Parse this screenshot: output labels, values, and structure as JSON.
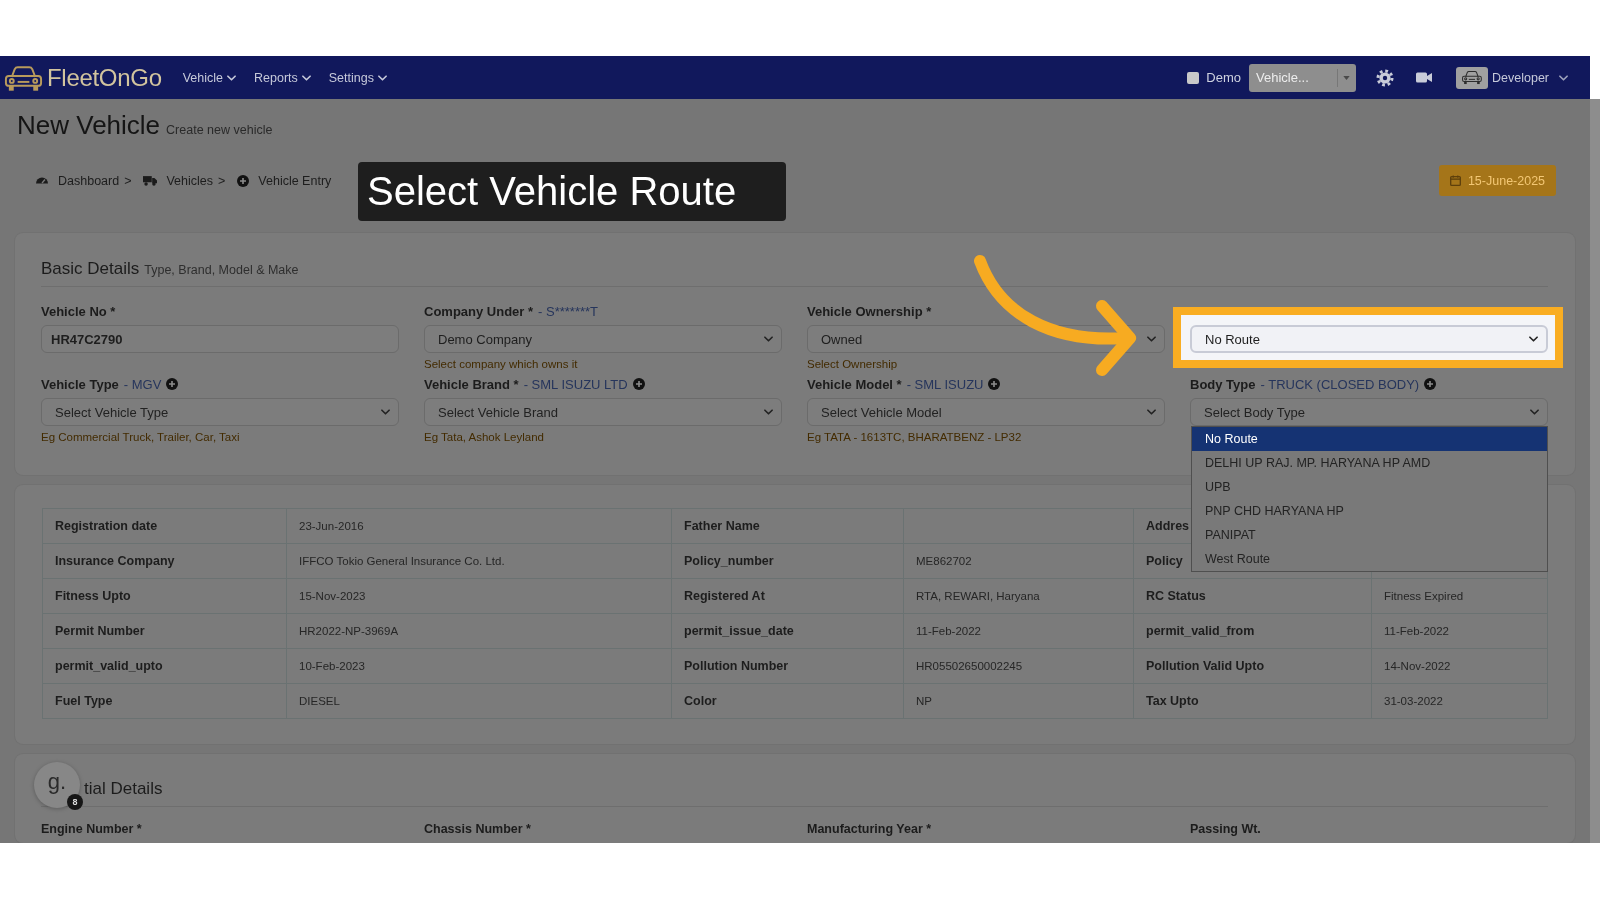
{
  "navbar": {
    "logo": "FleetOnGo",
    "menu": [
      {
        "label": "Vehicle"
      },
      {
        "label": "Reports"
      },
      {
        "label": "Settings"
      }
    ],
    "demo": {
      "label": "Demo",
      "checked": false
    },
    "vehicle_select": {
      "value": "Vehicle..."
    },
    "user": {
      "name": "Developer"
    }
  },
  "page_header": {
    "title": "New Vehicle",
    "subtitle": "Create new vehicle"
  },
  "breadcrumb": [
    {
      "kind": "dashboard",
      "label": "Dashboard",
      "separator": ">"
    },
    {
      "kind": "vehicles",
      "label": "Vehicles",
      "separator": ">"
    },
    {
      "kind": "entry",
      "label": "Vehicle Entry"
    }
  ],
  "tutorial": {
    "callout": "Select Vehicle Route"
  },
  "date_button": {
    "label": "15-June-2025"
  },
  "basic_details": {
    "title": "Basic Details",
    "subtitle": "Type, Brand, Model & Make",
    "fields": [
      {
        "kind": "input",
        "label": "Vehicle No *",
        "add_button": false,
        "spotlight": false,
        "value": "HR47C2790"
      },
      {
        "kind": "select",
        "label": "Company Under *",
        "note": "- S*******T",
        "add_button": false,
        "spotlight": false,
        "value": "Demo Company",
        "hint": "Select company which owns it"
      },
      {
        "kind": "select",
        "label": "Vehicle Ownership *",
        "add_button": false,
        "spotlight": false,
        "value": "Owned",
        "hint": "Select Ownership"
      },
      {
        "kind": "select",
        "add_button": false,
        "spotlight": true,
        "value": "No Route",
        "options": [
          {
            "label": "No Route",
            "selected": true
          },
          {
            "label": "DELHI UP RAJ. MP. HARYANA HP AMD",
            "selected": false
          },
          {
            "label": "UPB",
            "selected": false
          },
          {
            "label": "PNP CHD HARYANA HP",
            "selected": false
          },
          {
            "label": "PANIPAT",
            "selected": false
          },
          {
            "label": "West Route",
            "selected": false
          }
        ]
      },
      {
        "kind": "select",
        "label": "Vehicle Type",
        "note": "- MGV",
        "add_button": true,
        "spotlight": false,
        "placeholder": "Select Vehicle Type",
        "hint": "Eg Commercial Truck, Trailer, Car, Taxi"
      },
      {
        "kind": "select",
        "label": "Vehicle Brand *",
        "note": "- SML ISUZU LTD",
        "add_button": true,
        "spotlight": false,
        "placeholder": "Select Vehicle Brand",
        "hint": "Eg Tata, Ashok Leyland"
      },
      {
        "kind": "select",
        "label": "Vehicle Model *",
        "note": "- SML ISUZU",
        "add_button": true,
        "spotlight": false,
        "placeholder": "Select Vehicle Model",
        "hint": "Eg TATA - 1613TC, BHARATBENZ - LP32"
      },
      {
        "kind": "select",
        "label": "Body Type",
        "note": "- TRUCK (CLOSED BODY)",
        "add_button": true,
        "spotlight": false,
        "placeholder": "Select Body Type"
      }
    ]
  },
  "details_table": {
    "rows": [
      {
        "cells": [
          {
            "label": "Registration date",
            "value": "23-Jun-2016"
          },
          {
            "label": "Father Name"
          },
          {
            "label": "Addres"
          }
        ]
      },
      {
        "cells": [
          {
            "label": "Insurance Company",
            "value": "IFFCO Tokio General Insurance Co. Ltd."
          },
          {
            "label": "Policy_number",
            "value": "ME862702"
          },
          {
            "label": "Policy"
          }
        ]
      },
      {
        "cells": [
          {
            "label": "Fitness Upto",
            "value": "15-Nov-2023"
          },
          {
            "label": "Registered At",
            "value": "RTA, REWARI, Haryana"
          },
          {
            "label": "RC Status",
            "value": "Fitness Expired"
          }
        ]
      },
      {
        "cells": [
          {
            "label": "Permit Number",
            "value": "HR2022-NP-3969A"
          },
          {
            "label": "permit_issue_date",
            "value": "11-Feb-2022"
          },
          {
            "label": "permit_valid_from",
            "value": "11-Feb-2022"
          }
        ]
      },
      {
        "cells": [
          {
            "label": "permit_valid_upto",
            "value": "10-Feb-2023"
          },
          {
            "label": "Pollution Number",
            "value": "HR05502650002245"
          },
          {
            "label": "Pollution Valid Upto",
            "value": "14-Nov-2022"
          }
        ]
      },
      {
        "cells": [
          {
            "label": "Fuel Type",
            "value": "DIESEL"
          },
          {
            "label": "Color",
            "value": "NP"
          },
          {
            "label": "Tax Upto",
            "value": "31-03-2022"
          }
        ]
      }
    ]
  },
  "initial_details": {
    "title": "tial Details",
    "fields": [
      {
        "label": "Engine Number *"
      },
      {
        "label": "Chassis Number *"
      },
      {
        "label": "Manufacturing Year *"
      },
      {
        "label": "Passing Wt."
      }
    ]
  },
  "guide_widget": {
    "label": "g.",
    "badge": "8"
  }
}
